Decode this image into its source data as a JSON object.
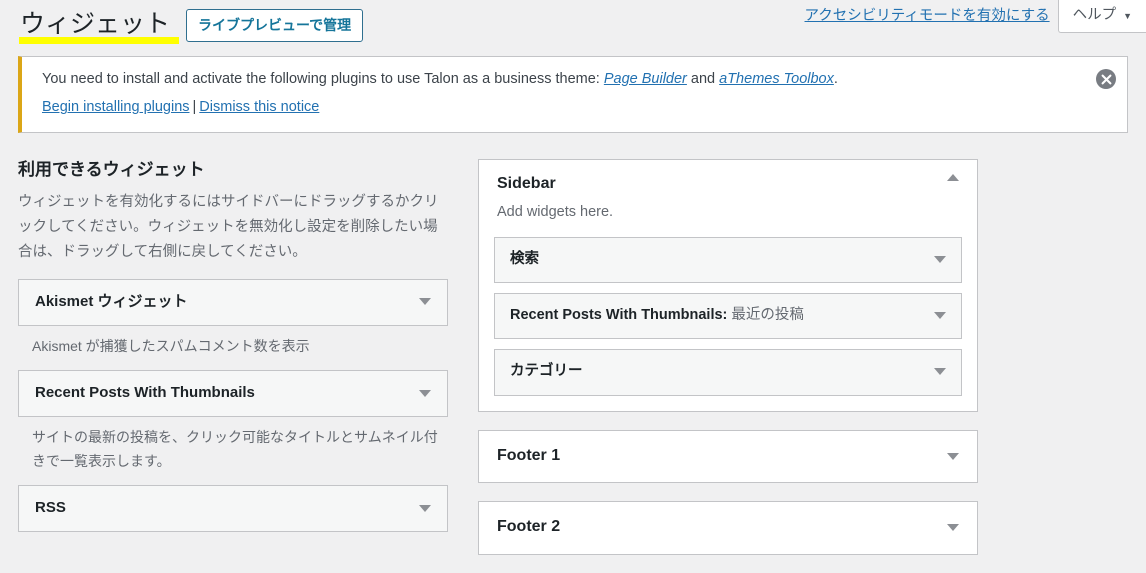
{
  "header": {
    "page_title": "ウィジェット",
    "live_preview_button": "ライブプレビューで管理",
    "accessibility_link": "アクセシビリティモードを有効にする",
    "help_tab": "ヘルプ",
    "help_caret": "▼"
  },
  "notice": {
    "text_before": "You need to install and activate the following plugins to use Talon as a business theme: ",
    "plugin_one": "Page Builder",
    "text_between": " and ",
    "plugin_two": "aThemes Toolbox",
    "text_after": ".",
    "action_install": "Begin installing plugins",
    "separator": "|",
    "action_dismiss": "Dismiss this notice",
    "accent_color": "#dba617",
    "dismiss_icon": "close-circle-icon"
  },
  "available_widgets": {
    "heading": "利用できるウィジェット",
    "description": "ウィジェットを有効化するにはサイドバーにドラッグするかクリックしてください。ウィジェットを無効化し設定を削除したい場合は、ドラッグして右側に戻してください。",
    "items": [
      {
        "name": "Akismet ウィジェット",
        "description": "Akismet が捕獲したスパムコメント数を表示",
        "toggle_icon": "chevron-down-icon"
      },
      {
        "name": "Recent Posts With Thumbnails",
        "description": "サイトの最新の投稿を、クリック可能なタイトルとサムネイル付きで一覧表示します。",
        "toggle_icon": "chevron-down-icon"
      },
      {
        "name": "RSS",
        "description": "",
        "toggle_icon": "chevron-down-icon"
      }
    ]
  },
  "sidebars": [
    {
      "title": "Sidebar",
      "subtitle": "Add widgets here.",
      "expanded": true,
      "toggle_icon": "chevron-up-icon",
      "widgets": [
        {
          "title": "検索",
          "suffix": "",
          "toggle_icon": "chevron-down-icon"
        },
        {
          "title": "Recent Posts With Thumbnails:",
          "suffix": " 最近の投稿",
          "toggle_icon": "chevron-down-icon"
        },
        {
          "title": "カテゴリー",
          "suffix": "",
          "toggle_icon": "chevron-down-icon"
        }
      ]
    },
    {
      "title": "Footer 1",
      "subtitle": "",
      "expanded": false,
      "toggle_icon": "chevron-down-icon",
      "widgets": []
    },
    {
      "title": "Footer 2",
      "subtitle": "",
      "expanded": false,
      "toggle_icon": "chevron-down-icon",
      "widgets": []
    }
  ]
}
